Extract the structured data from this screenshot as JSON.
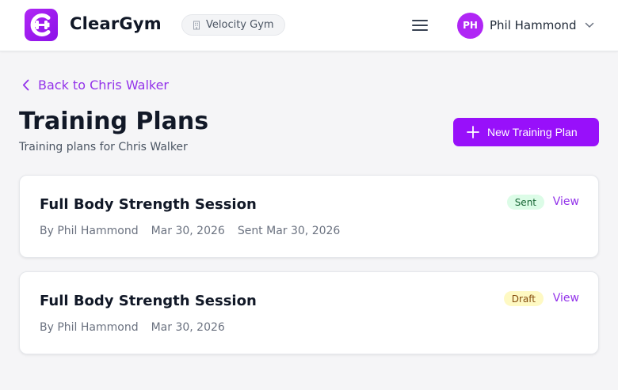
{
  "header": {
    "brand": "ClearGym",
    "brand_color": "#b026f5",
    "gym_name": "Velocity Gym",
    "gym_icon": "building-icon",
    "menu_icon": "hamburger-menu-icon",
    "user": {
      "initials": "PH",
      "name": "Phil Hammond"
    }
  },
  "main": {
    "back_label": "Back to Chris Walker",
    "title": "Training Plans",
    "subtitle": "Training plans for Chris Walker",
    "new_button_label": "New Training Plan",
    "accent_color": "#9810fa",
    "plans": [
      {
        "title": "Full Body Strength Session",
        "author": "By Phil Hammond",
        "date": "Mar 30, 2026",
        "sent": "Sent Mar 30, 2026",
        "status": "Sent",
        "view_label": "View"
      },
      {
        "title": "Full Body Strength Session",
        "author": "By Phil Hammond",
        "date": "Mar 30, 2026",
        "status": "Draft",
        "view_label": "View"
      }
    ]
  }
}
